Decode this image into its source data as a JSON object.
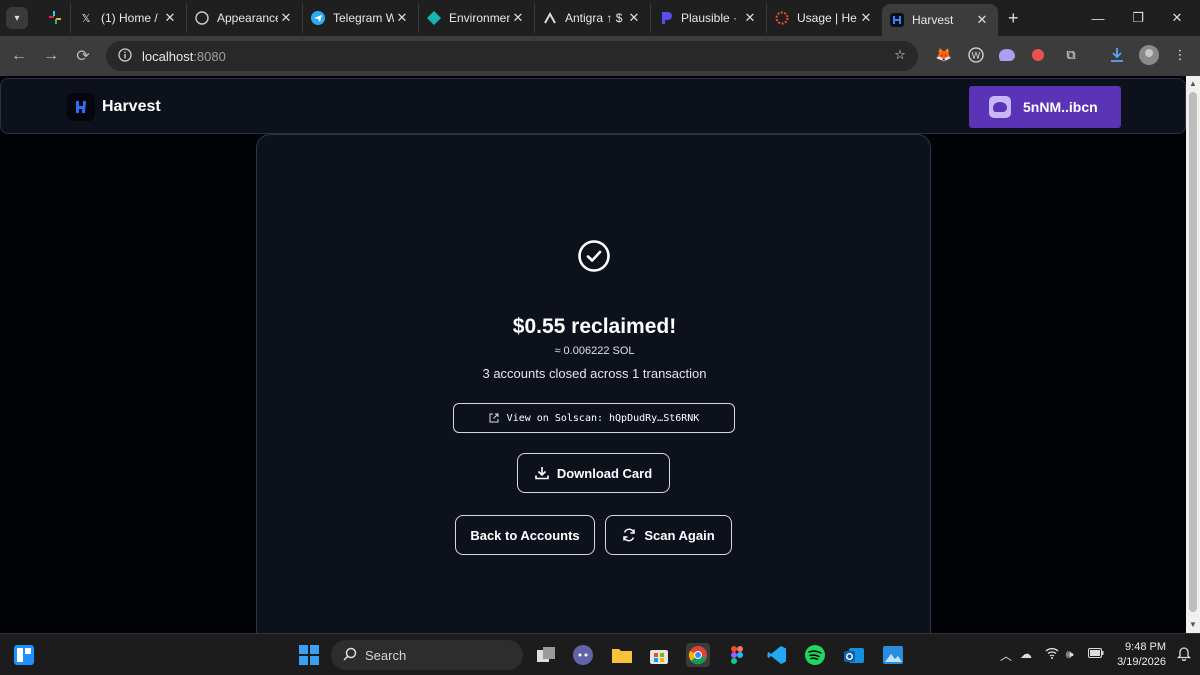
{
  "browser": {
    "tabs": [
      {
        "title": "(1) Home /",
        "favicon": "x-logo-icon"
      },
      {
        "title": "Appearance",
        "favicon": "github-icon"
      },
      {
        "title": "Telegram W",
        "favicon": "telegram-icon"
      },
      {
        "title": "Environmen",
        "favicon": "diamond-icon"
      },
      {
        "title": "Antigra ↑ $",
        "favicon": "antigravity-icon"
      },
      {
        "title": "Plausible ·",
        "favicon": "plausible-icon"
      },
      {
        "title": "Usage | He",
        "favicon": "helius-icon"
      },
      {
        "title": "Harvest",
        "favicon": "harvest-icon",
        "active": true
      }
    ],
    "address": {
      "host": "localhost",
      "port": ":8080"
    }
  },
  "app": {
    "brand": "Harvest",
    "wallet_label": "5nNM..ibcn",
    "accent_color": "#5b33b6"
  },
  "result": {
    "amount_text": "$0.55 reclaimed!",
    "sol_text": "≈ 0.006222 SOL",
    "summary_text": "3 accounts closed across 1 transaction",
    "solscan_label": "View on Solscan: hQpDudRy…St6RNK",
    "download_label": "Download Card",
    "back_label": "Back to Accounts",
    "scan_label": "Scan Again"
  },
  "taskbar": {
    "search_placeholder": "Search",
    "time": "9:48 PM",
    "date": "3/19/2026"
  }
}
